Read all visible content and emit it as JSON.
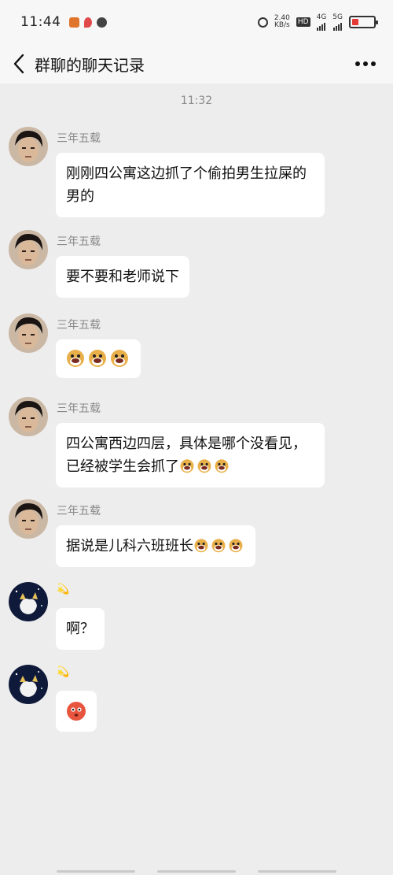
{
  "status_bar": {
    "time": "11:44",
    "speed_value": "2.40",
    "speed_unit": "KB/s",
    "hd": "HD",
    "net1": "4G",
    "net2": "5G"
  },
  "nav": {
    "title": "群聊的聊天记录"
  },
  "chat": {
    "timestamp": "11:32",
    "messages": [
      {
        "sender": "三年五载",
        "text": "刚刚四公寓这边抓了个偷拍男生拉屎的男的",
        "emoji_count": 0
      },
      {
        "sender": "三年五载",
        "text": "要不要和老师说下",
        "emoji_count": 0
      },
      {
        "sender": "三年五载",
        "text": "",
        "emoji_count": 3
      },
      {
        "sender": "三年五载",
        "text": "四公寓西边四层，具体是哪个没看见，已经被学生会抓了",
        "emoji_count": 3
      },
      {
        "sender": "三年五载",
        "text": "据说是儿科六班班长",
        "emoji_count": 3
      },
      {
        "sender": "💫",
        "text": "啊？",
        "emoji_count": 0
      },
      {
        "sender": "💫",
        "text": "",
        "emoji_count": 0,
        "emoji": "flushed-face"
      }
    ]
  },
  "icons": {
    "back": "chevron-left-icon",
    "more": "more-dots-icon",
    "face": "grinning-dog-emoji"
  },
  "colors": {
    "background": "#ededed",
    "bubble": "#ffffff",
    "battery_low": "#e53935"
  }
}
